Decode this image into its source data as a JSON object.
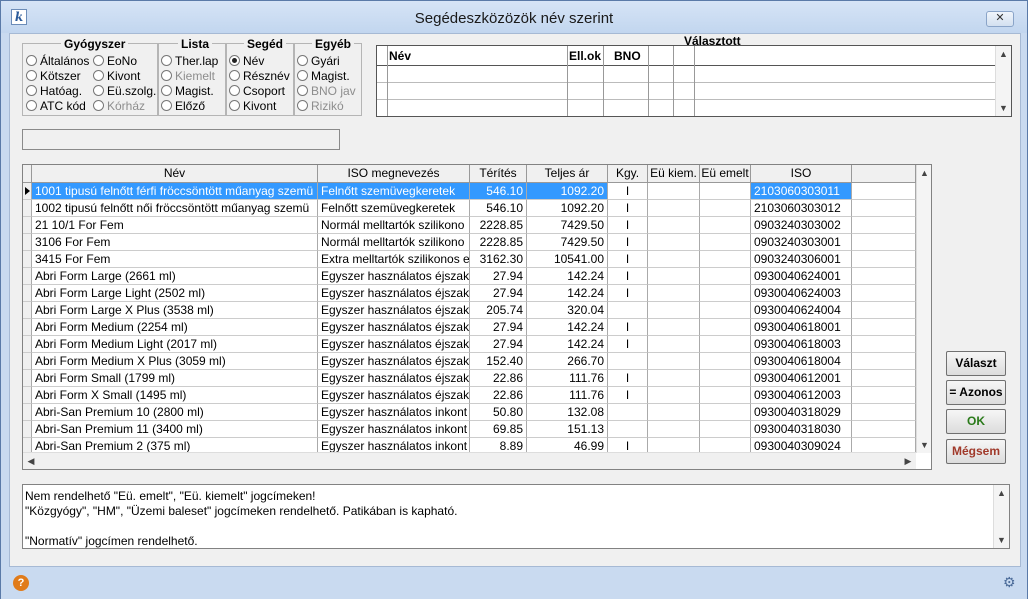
{
  "window": {
    "title": "Segédeszközözök név szerint",
    "close_glyph": "✕"
  },
  "groups": {
    "gyogyszer": {
      "title": "Gyógyszer",
      "options": [
        "Általános",
        "Kötszer",
        "Hatóag.",
        "ATC kód",
        "EoNo",
        "Kivont",
        "Eü.szolg.",
        "Kórház"
      ]
    },
    "lista": {
      "title": "Lista",
      "options": [
        "Ther.lap",
        "Kiemelt",
        "Magist.",
        "Előző"
      ]
    },
    "seged": {
      "title": "Segéd",
      "options": [
        "Név",
        "Résznév",
        "Csoport",
        "Kivont"
      ]
    },
    "egyeb": {
      "title": "Egyéb",
      "options": [
        "Gyári",
        "Magist.",
        "BNO jav",
        "Rizikó"
      ]
    }
  },
  "selected_panel": {
    "title": "Választott",
    "headers": [
      "Név",
      "Ell.ok",
      "BNO"
    ]
  },
  "grid": {
    "headers": [
      "Név",
      "ISO megnevezés",
      "Térítés",
      "Teljes ár",
      "Kgy.",
      "Eü kiem.",
      "Eü emelt",
      "ISO"
    ],
    "rows": [
      [
        "1001 tipusú felnőtt férfi fröccsöntött műanyag szemü",
        "Felnőtt szemüvegkeretek",
        "546.10",
        "1092.20",
        "I",
        "",
        "",
        "2103060303011"
      ],
      [
        "1002 tipusú felnőtt női fröccsöntött műanyag szemü",
        "Felnőtt szemüvegkeretek",
        "546.10",
        "1092.20",
        "I",
        "",
        "",
        "2103060303012"
      ],
      [
        "21 10/1 For Fem",
        "Normál melltartók szilikono",
        "2228.85",
        "7429.50",
        "I",
        "",
        "",
        "0903240303002"
      ],
      [
        "3106 For Fem",
        "Normál melltartók szilikono",
        "2228.85",
        "7429.50",
        "I",
        "",
        "",
        "0903240303001"
      ],
      [
        "3415 For Fem",
        "Extra melltartók szilikonos e",
        "3162.30",
        "10541.00",
        "I",
        "",
        "",
        "0903240306001"
      ],
      [
        "Abri Form Large (2661 ml)",
        "Egyszer használatos éjszak",
        "27.94",
        "142.24",
        "I",
        "",
        "",
        "0930040624001"
      ],
      [
        "Abri Form Large Light (2502 ml)",
        "Egyszer használatos éjszak",
        "27.94",
        "142.24",
        "I",
        "",
        "",
        "0930040624003"
      ],
      [
        "Abri Form Large X Plus (3538 ml)",
        "Egyszer használatos éjszak",
        "205.74",
        "320.04",
        "",
        "",
        "",
        "0930040624004"
      ],
      [
        "Abri Form Medium (2254 ml)",
        "Egyszer használatos éjszak",
        "27.94",
        "142.24",
        "I",
        "",
        "",
        "0930040618001"
      ],
      [
        "Abri Form Medium Light (2017 ml)",
        "Egyszer használatos éjszak",
        "27.94",
        "142.24",
        "I",
        "",
        "",
        "0930040618003"
      ],
      [
        "Abri Form Medium X Plus (3059 ml)",
        "Egyszer használatos éjszak",
        "152.40",
        "266.70",
        "",
        "",
        "",
        "0930040618004"
      ],
      [
        "Abri Form Small (1799 ml)",
        "Egyszer használatos éjszak",
        "22.86",
        "111.76",
        "I",
        "",
        "",
        "0930040612001"
      ],
      [
        "Abri Form X Small (1495 ml)",
        "Egyszer használatos éjszak",
        "22.86",
        "111.76",
        "I",
        "",
        "",
        "0930040612003"
      ],
      [
        "Abri-San Premium 10 (2800 ml)",
        "Egyszer használatos inkont",
        "50.80",
        "132.08",
        "",
        "",
        "",
        "0930040318029"
      ],
      [
        "Abri-San Premium 11 (3400 ml)",
        "Egyszer használatos inkont",
        "69.85",
        "151.13",
        "",
        "",
        "",
        "0930040318030"
      ],
      [
        "Abri-San Premium 2 (375 ml)",
        "Egyszer használatos inkont",
        "8.89",
        "46.99",
        "I",
        "",
        "",
        "0930040309024"
      ]
    ]
  },
  "buttons": {
    "valaszt": "Választ",
    "azonos": "= Azonos",
    "ok": "OK",
    "megsem": "Mégsem"
  },
  "memo": [
    "Nem rendelhető \"Eü. emelt\", \"Eü. kiemelt\" jogcímeken!",
    "\"Közgyógy\", \"HM\", \"Üzemi baleset\" jogcímeken rendelhető. Patikában is kapható.",
    "",
    "\"Normatív\" jogcímen rendelhető."
  ],
  "status": {
    "help": "?"
  }
}
